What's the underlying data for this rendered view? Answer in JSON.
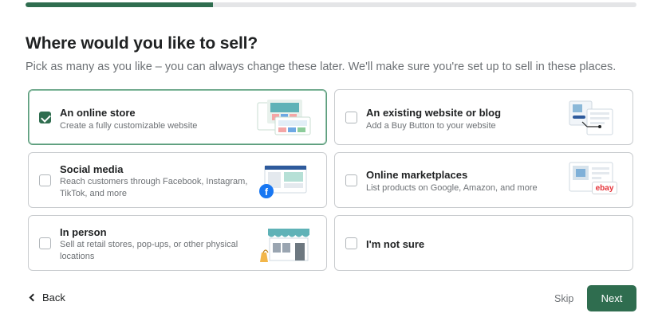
{
  "progress": {
    "fraction": 0.307
  },
  "heading": "Where would you like to sell?",
  "subheading": "Pick as many as you like – you can always change these later. We'll make sure you're set up to sell in these places.",
  "options": [
    {
      "title": "An online store",
      "description": "Create a fully customizable website",
      "checked": true,
      "icon": "online-store-illustration"
    },
    {
      "title": "An existing website or blog",
      "description": "Add a Buy Button to your website",
      "checked": false,
      "icon": "buy-button-illustration"
    },
    {
      "title": "Social media",
      "description": "Reach customers through Facebook, Instagram, TikTok, and more",
      "checked": false,
      "icon": "social-media-illustration"
    },
    {
      "title": "Online marketplaces",
      "description": "List products on Google, Amazon, and more",
      "checked": false,
      "icon": "marketplace-illustration",
      "badge": "ebay"
    },
    {
      "title": "In person",
      "description": "Sell at retail stores, pop-ups, or other physical locations",
      "checked": false,
      "icon": "storefront-illustration"
    },
    {
      "title": "I'm not sure",
      "description": "",
      "checked": false,
      "icon": ""
    }
  ],
  "footer": {
    "back_label": "Back",
    "skip_label": "Skip",
    "next_label": "Next"
  },
  "colors": {
    "accent": "#2f6d4f",
    "border": "#c9cccf",
    "selected_border": "#5c9c7c"
  }
}
